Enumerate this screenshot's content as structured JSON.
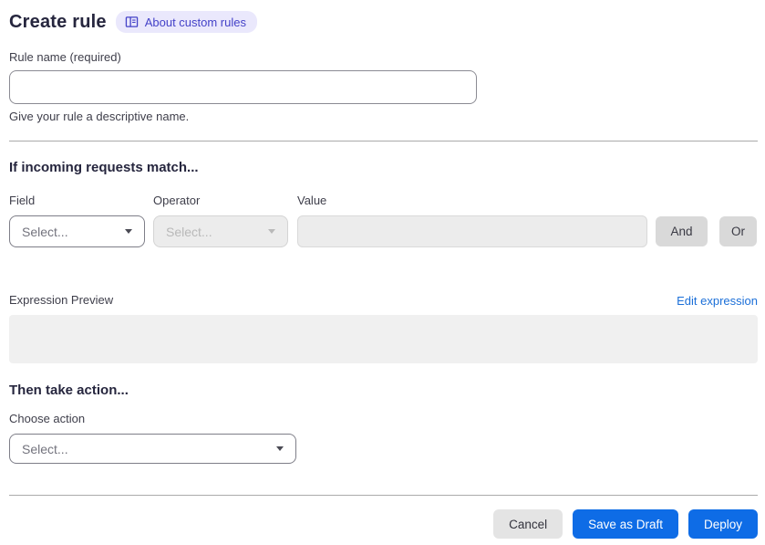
{
  "header": {
    "title": "Create rule",
    "about_badge_label": "About custom rules"
  },
  "rule_name": {
    "label": "Rule name (required)",
    "value": "",
    "placeholder": "",
    "helper": "Give your rule a descriptive name."
  },
  "match_section": {
    "heading": "If incoming requests match...",
    "field": {
      "label": "Field",
      "selected": "Select..."
    },
    "operator": {
      "label": "Operator",
      "selected": "Select..."
    },
    "value": {
      "label": "Value",
      "value": "",
      "placeholder": ""
    },
    "and_label": "And",
    "or_label": "Or"
  },
  "expression": {
    "label": "Expression Preview",
    "edit_link": "Edit expression",
    "content": ""
  },
  "action_section": {
    "heading": "Then take action...",
    "choose_label": "Choose action",
    "selected": "Select..."
  },
  "footer": {
    "cancel_label": "Cancel",
    "save_draft_label": "Save as Draft",
    "deploy_label": "Deploy"
  },
  "colors": {
    "primary_blue": "#0e6ce6",
    "link_blue": "#1b6fd8",
    "badge_bg": "#eae8fc",
    "badge_text": "#4442c8",
    "heading_text": "#26263e",
    "disabled_bg": "#ececec",
    "logic_button_bg": "#d9d9d9",
    "preview_box_bg": "#f0f0f0",
    "divider": "#ababab"
  }
}
